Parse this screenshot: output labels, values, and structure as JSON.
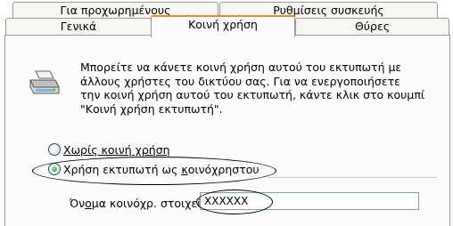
{
  "tabs": {
    "back_row": [
      "Για προχωρημένους",
      "Ρυθμίσεις συσκευής"
    ],
    "front_row": [
      "Γενικά",
      "Κοινή χρήση",
      "Θύρες"
    ],
    "active": "Κοινή χρήση"
  },
  "sharing": {
    "description_lines": [
      "Μπορείτε να κάνετε κοινή χρήση αυτού του εκτυπωτή με",
      "άλλους χρήστες του δικτύου σας. Για να ενεργοποιήσετε",
      "την κοινή χρήση αυτού του εκτυπωτή, κάντε κλικ στο κουμπί",
      "\"Κοινή χρήση εκτυπωτή\"."
    ],
    "option_not_shared": {
      "pre": "",
      "mnemonic": "Χ",
      "post": "ωρίς κοινή χρήση",
      "checked": false
    },
    "option_shared": {
      "pre": "Χρήση εκτυπωτή ως ",
      "mnemonic": "κ",
      "post": "οινόχρηστου",
      "checked": true
    },
    "share_name_label": {
      "pre": "Όν",
      "mnemonic": "ο",
      "post": "μα κοινόχρ. στοιχείου:"
    },
    "share_name_value": "XXXXXX"
  }
}
